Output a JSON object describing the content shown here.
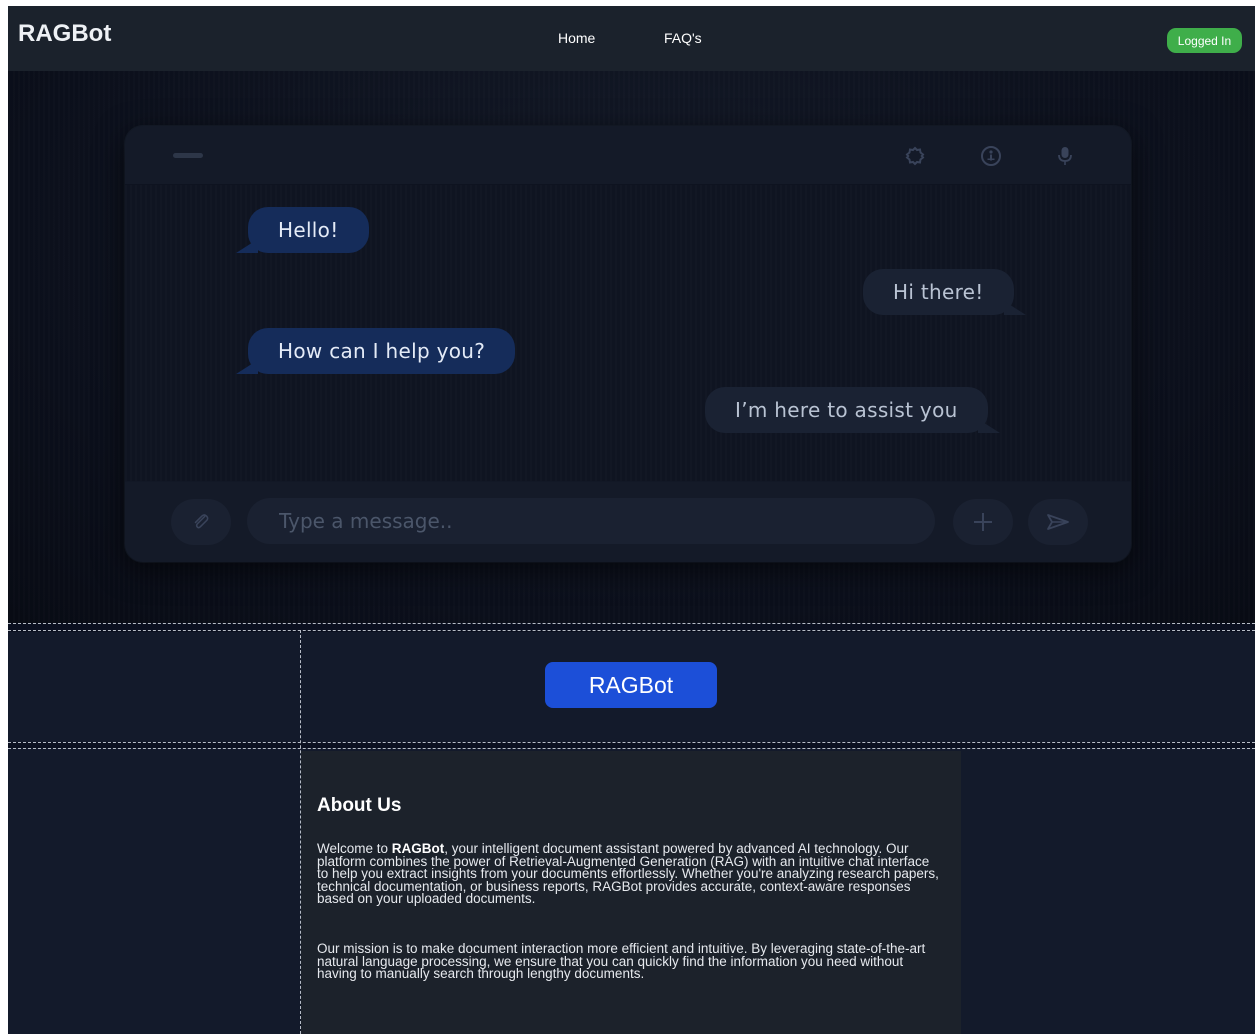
{
  "nav": {
    "brand": "RAGBot",
    "links": [
      "Home",
      "FAQ's"
    ],
    "login_label": "Logged In"
  },
  "chat": {
    "messages": [
      {
        "side": "left",
        "text": "Hello!"
      },
      {
        "side": "right",
        "text": "Hi there!"
      },
      {
        "side": "left",
        "text": "How can I help you?"
      },
      {
        "side": "right",
        "text": "I’m here to assist you"
      }
    ],
    "input_placeholder": "Type a message.."
  },
  "section": {
    "ragbot_button": "RAGBot"
  },
  "about": {
    "title": "About Us",
    "p1_prefix": "Welcome to ",
    "p1_brand": "RAGBot",
    "p1_rest": ", your intelligent document assistant powered by advanced AI technology. Our platform combines the power of Retrieval-Augmented Generation (RAG) with an intuitive chat interface to help you extract insights from your documents effortlessly. Whether you're analyzing research papers, technical documentation, or business reports, RAGBot provides accurate, context-aware responses based on your uploaded documents.",
    "p2": "Our mission is to make document interaction more efficient and intuitive. By leveraging state-of-the-art natural language processing, we ensure that you can quickly find the information you need without having to manually search through lengthy documents."
  },
  "colors": {
    "accent_blue": "#1c4fd8",
    "login_green": "#3fae4a",
    "nav_bg": "#1b222c",
    "page_bg": "#0b1020"
  },
  "icons": [
    "minimize-icon",
    "settings-icon",
    "info-icon",
    "microphone-icon",
    "paperclip-icon",
    "plus-icon",
    "send-icon"
  ]
}
